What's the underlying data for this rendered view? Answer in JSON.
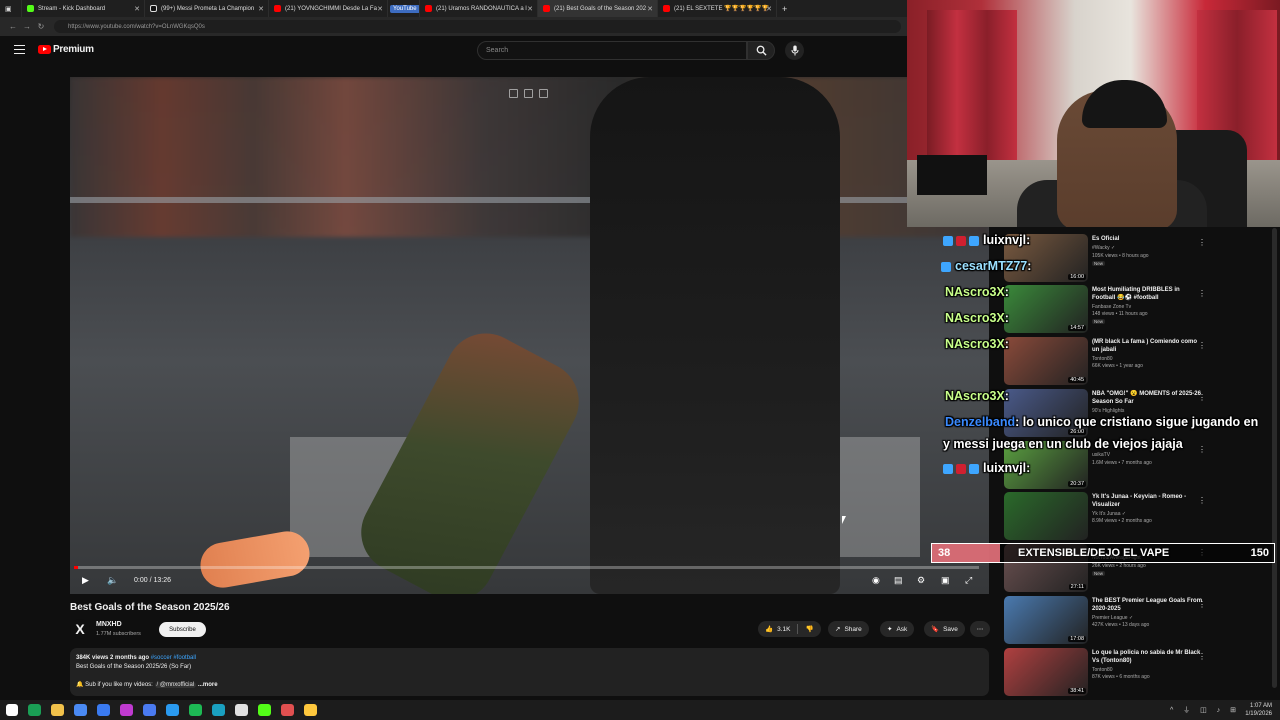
{
  "browser": {
    "tabs": [
      {
        "label": "Stream - Kick Dashboard",
        "color": "#53fc18",
        "active": false
      },
      {
        "label": "(99+) Messi Prometa La Champion",
        "color": "#ffffff",
        "active": false
      },
      {
        "label": "(21) YOVNGCHIMMI Desde La Fa",
        "color": "#ff0000",
        "active": false
      },
      {
        "label": "YouTube",
        "color": "#ff0000",
        "active": true
      },
      {
        "label": "(21) Uramos RANDONAUTICA a l",
        "color": "#ff0000",
        "active": false
      },
      {
        "label": "(21) Best Goals of the Season 202",
        "color": "#ff0000",
        "active": false
      },
      {
        "label": "(21) EL SEXTETE 🏆🏆🏆🏆🏆🏆",
        "color": "#ff0000",
        "active": false
      }
    ],
    "new_tab": "+",
    "url": "https://www.youtube.com/watch?v=OLnWGKqsQ0s"
  },
  "youtube": {
    "logo_text": "Premium",
    "search_placeholder": "Search",
    "video": {
      "title": "Best Goals of the Season 2025/26",
      "time_current": "0:00",
      "time_total": "13:26",
      "time_sep": " / ",
      "progress": 0.0
    },
    "channel": {
      "avatar_glyph": "X",
      "name": "MNXHD",
      "subs": "1.77M subscribers",
      "subscribe_label": "Subscribe"
    },
    "actions": {
      "likes": "3.1K",
      "share": "Share",
      "ask": "Ask",
      "save": "Save"
    },
    "description": {
      "meta": "384K views  2 months ago",
      "tags": "#soccer #football",
      "line2": "Best Goals of the Season 2025/26 (So Far)",
      "line3": "🔔 Sub if you like my videos:",
      "link": "/ @mnxofficial",
      "more": "...more"
    }
  },
  "recommendations": [
    {
      "title": "Es Oficial",
      "channel": "#Wacky ✓",
      "views": "105K views • 8 hours ago",
      "badge": "New",
      "duration": "16:00",
      "thumb": "#7a5a40"
    },
    {
      "title": "Most Humiliating DRIBBLES in Football 😂⚽ #football",
      "channel": "Fanbase Zone Tv",
      "views": "148 views • 11 hours ago",
      "badge": "New",
      "duration": "14:57",
      "thumb": "#3a8a3a"
    },
    {
      "title": "(MR black La fama ) Comiendo como un jabali",
      "channel": "Tonton80",
      "views": "66K views • 1 year ago",
      "badge": "",
      "duration": "40:45",
      "thumb": "#8a4a3a"
    },
    {
      "title": "NBA \"OMG!\" 😮 MOMENTS of 2025-26 Season So Far",
      "channel": "90's Highlights",
      "views": "",
      "badge": "",
      "duration": "26:00",
      "thumb": "#4a5a8a"
    },
    {
      "title": "",
      "channel": "usikaTV",
      "views": "1.6M views • 7 months ago",
      "badge": "",
      "duration": "20:37",
      "thumb": "#5aa040"
    },
    {
      "title": "Yk It's Junaa - Keyvian - Romeo - Visualizer",
      "channel": "Yk It's Junaa ✓",
      "views": "8.9M views • 2 months ago",
      "badge": "",
      "duration": "",
      "thumb": "#2a6a2a"
    },
    {
      "title": "",
      "channel": "NotYourAverageFlight",
      "views": "26K views • 2 hours ago",
      "badge": "New",
      "duration": "27:11",
      "thumb": "#6a5050"
    },
    {
      "title": "The BEST Premier League Goals From 2020-2025",
      "channel": "Premier League ✓",
      "views": "427K views • 13 days ago",
      "badge": "",
      "duration": "17:08",
      "thumb": "#4a7ab0"
    },
    {
      "title": "Lo que la policia no sabia de Mr Black Vs (Tonton80)",
      "channel": "Tonton80",
      "views": "87K views • 6 months ago",
      "badge": "",
      "duration": "38:41",
      "thumb": "#b04040"
    }
  ],
  "chat": [
    {
      "user": "luixnvjl",
      "text": ":",
      "color": "#ffffff",
      "badges": [
        "#3ea6ff",
        "#d02030",
        "#3ea6ff"
      ]
    },
    {
      "user": "cesarMTZ77",
      "text": ":",
      "color": "#9be0ff",
      "badges": [
        "#3ea6ff"
      ]
    },
    {
      "user": "NAscro3X",
      "text": ":",
      "color": "#c8ff8a",
      "badges": []
    },
    {
      "user": "NAscro3X",
      "text": ":",
      "color": "#c8ff8a",
      "badges": []
    },
    {
      "user": "NAscro3X",
      "text": ":",
      "color": "#c8ff8a",
      "badges": []
    },
    {
      "user": "NAscro3X",
      "text": ":",
      "color": "#c8ff8a",
      "badges": []
    },
    {
      "user": "Denzelband",
      "text": ": lo unico que cristiano sigue jugando en",
      "color": "#3a8aff",
      "badges": []
    },
    {
      "user": "",
      "text": "y messi juega en un club de viejos jajaja",
      "color": "#ffffff",
      "badges": []
    },
    {
      "user": "luixnvjl",
      "text": ":",
      "color": "#ffffff",
      "badges": [
        "#3ea6ff",
        "#d02030",
        "#3ea6ff"
      ]
    }
  ],
  "poll": {
    "left_value": "38",
    "title": "EXTENSIBLE/DEJO EL VAPE",
    "right_value": "150",
    "fill_fraction": 0.2,
    "fill_color": "#e8737d"
  },
  "taskbar": {
    "time": "1:07 AM",
    "date": "1/19/2026",
    "tray": "^ ⏚ ◫ ♪ ⊞",
    "icons": [
      "#ffffff",
      "#1a9e55",
      "#f2c24b",
      "#4a8af4",
      "#3a7af0",
      "#c03ad0",
      "#4a7af0",
      "#2a9af0",
      "#1db954",
      "#1aa0c0",
      "#e0e0e0",
      "#53fc18",
      "#e05050",
      "#ffc83d"
    ]
  }
}
